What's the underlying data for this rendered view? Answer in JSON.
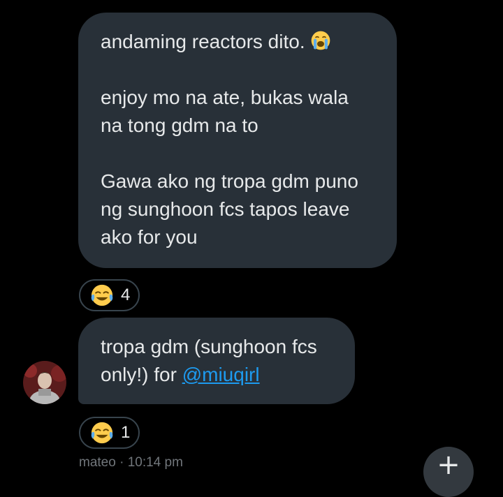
{
  "messages": [
    {
      "paragraphs": [
        "andaming reactors dito.",
        "enjoy mo na ate, bukas wala na tong gdm na to",
        "Gawa ako ng tropa gdm puno ng sunghoon fcs tapos leave ako for you"
      ],
      "inline_emoji": "loudly-crying-face",
      "reaction": {
        "emoji": "face-with-tears-of-joy",
        "count": "4"
      }
    },
    {
      "text_before": "tropa gdm (sunghoon fcs only!) for ",
      "mention": "@miuqirl",
      "reaction": {
        "emoji": "face-with-tears-of-joy",
        "count": "1"
      },
      "sender": "mateo",
      "timestamp": "10:14 pm"
    }
  ],
  "meta_separator": " · ",
  "fab_label": "+",
  "colors": {
    "background": "#000000",
    "bubble": "#283038",
    "text": "#e7e9ea",
    "mention": "#1d9bf0",
    "muted": "#71767b"
  }
}
